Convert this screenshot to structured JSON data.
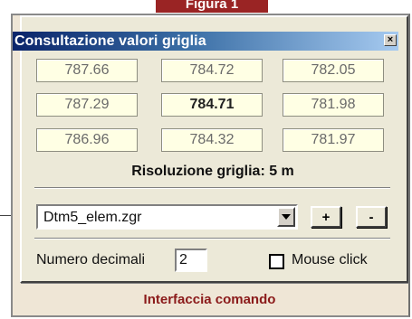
{
  "figure_tab": "Figura 1",
  "window": {
    "title": "Consultazione valori griglia",
    "close_glyph": "×"
  },
  "grid": {
    "cells": [
      "787.66",
      "784.72",
      "782.05",
      "787.29",
      "784.71",
      "781.98",
      "786.96",
      "784.32",
      "781.97"
    ]
  },
  "resolution_label": "Risoluzione griglia: 5 m",
  "file_select": {
    "value": "Dtm5_elem.zgr"
  },
  "buttons": {
    "plus": "+",
    "minus": "-"
  },
  "decimals": {
    "label": "Numero decimali",
    "value": "2"
  },
  "mouse_click": {
    "label": "Mouse click",
    "checked": false
  },
  "caption": "Interfaccia comando"
}
